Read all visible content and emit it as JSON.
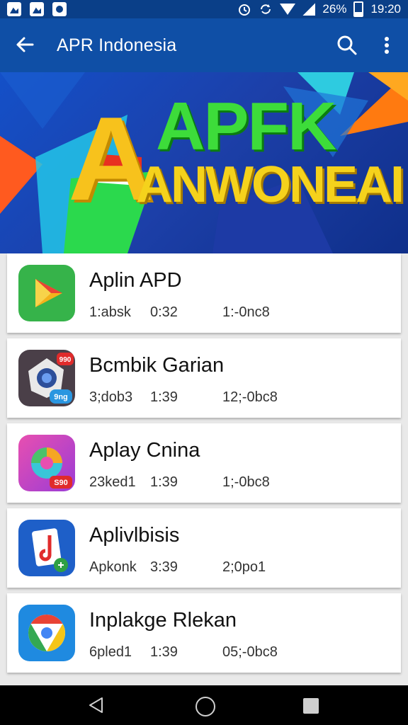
{
  "status_bar": {
    "battery": "26%",
    "time": "19:20",
    "icons": [
      "image-icon",
      "photo-icon",
      "circle-app-icon",
      "alarm-icon",
      "rotate-icon",
      "wifi-icon",
      "signal-icon",
      "battery-icon"
    ]
  },
  "app_bar": {
    "title": "APR Indonesia",
    "icons": [
      "back-arrow-icon",
      "search-icon",
      "more-vert-icon"
    ],
    "color": "#0f4fa6"
  },
  "banner": {
    "line1": "APFK",
    "line2": "ANWONEAI",
    "big_letter": "A"
  },
  "apps": [
    {
      "name": "Aplin APD",
      "meta1": "1:absk",
      "meta2": "0:32",
      "meta3": "1:-0nc8"
    },
    {
      "name": "Bcmbik Garian",
      "meta1": "3;dob3",
      "meta2": "1:39",
      "meta3": "12;-0bc8"
    },
    {
      "name": "Aplay Cnina",
      "meta1": "23ked1",
      "meta2": "1:39",
      "meta3": "1;-0bc8"
    },
    {
      "name": "Aplivlbisis",
      "meta1": "Apkonk",
      "meta2": "3:39",
      "meta3": "2;0po1"
    },
    {
      "name": "Inplakge Rlekan",
      "meta1": "6pled1",
      "meta2": "1:39",
      "meta3": "05;-0bc8"
    }
  ],
  "app_icon_badges": {
    "app2_top": "990",
    "app2_bottom": "9ng",
    "app3": "S90"
  },
  "nav_bar": {
    "icons": [
      "nav-back-icon",
      "nav-home-icon",
      "nav-recents-icon"
    ]
  }
}
